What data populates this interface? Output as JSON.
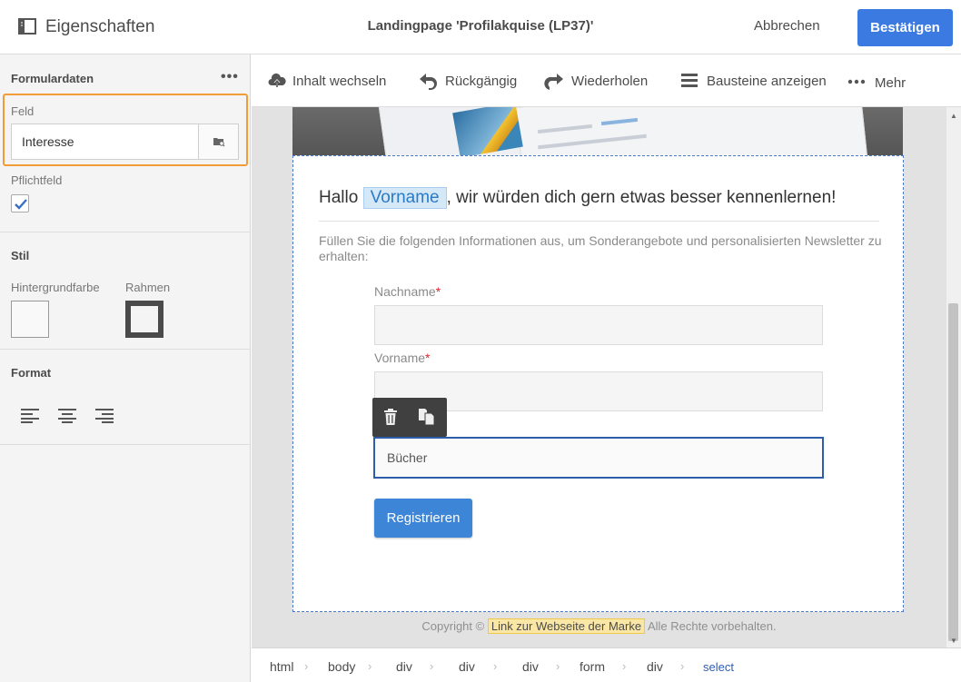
{
  "header": {
    "panel_title": "Eigenschaften",
    "doc_title": "Landingpage 'Profilakquise (LP37)'",
    "cancel_label": "Abbrechen",
    "confirm_label": "Bestätigen",
    "accent_color": "#3b7be1"
  },
  "properties": {
    "form_section_title": "Formulardaten",
    "field_label": "Feld",
    "field_value": "Interesse",
    "required_label": "Pflichtfeld",
    "required_checked": true,
    "style_section_title": "Stil",
    "bg_color_label": "Hintergrundfarbe",
    "border_label": "Rahmen",
    "format_section_title": "Format",
    "highlight_color": "#f29c38"
  },
  "toolbar": {
    "items": [
      {
        "label": "Inhalt wechseln",
        "icon": "cloud-upload-icon"
      },
      {
        "label": "Rückgängig",
        "icon": "undo-icon"
      },
      {
        "label": "Wiederholen",
        "icon": "redo-icon"
      },
      {
        "label": "Bausteine anzeigen",
        "icon": "blocks-icon"
      },
      {
        "label": "Mehr",
        "icon": "more-icon"
      }
    ]
  },
  "page": {
    "greeting_before": "Hallo ",
    "greeting_field": "Vorname",
    "greeting_after": ", wir würden dich gern etwas besser kennenlernen!",
    "intro": "Füllen Sie die folgenden Informationen aus, um Sonderangebote und personalisierten Newsletter zu erhalten:",
    "lastname_label": "Nachname",
    "firstname_label": "Vorname",
    "required_marker": "*",
    "select_value": "Bücher",
    "submit_label": "Registrieren",
    "footer_before": "Copyright © ",
    "footer_link": "Link zur Webseite der Marke",
    "footer_after": " Alle Rechte vorbehalten."
  },
  "breadcrumb": [
    "html",
    "body",
    "div",
    "div",
    "div",
    "form",
    "div",
    "select"
  ]
}
